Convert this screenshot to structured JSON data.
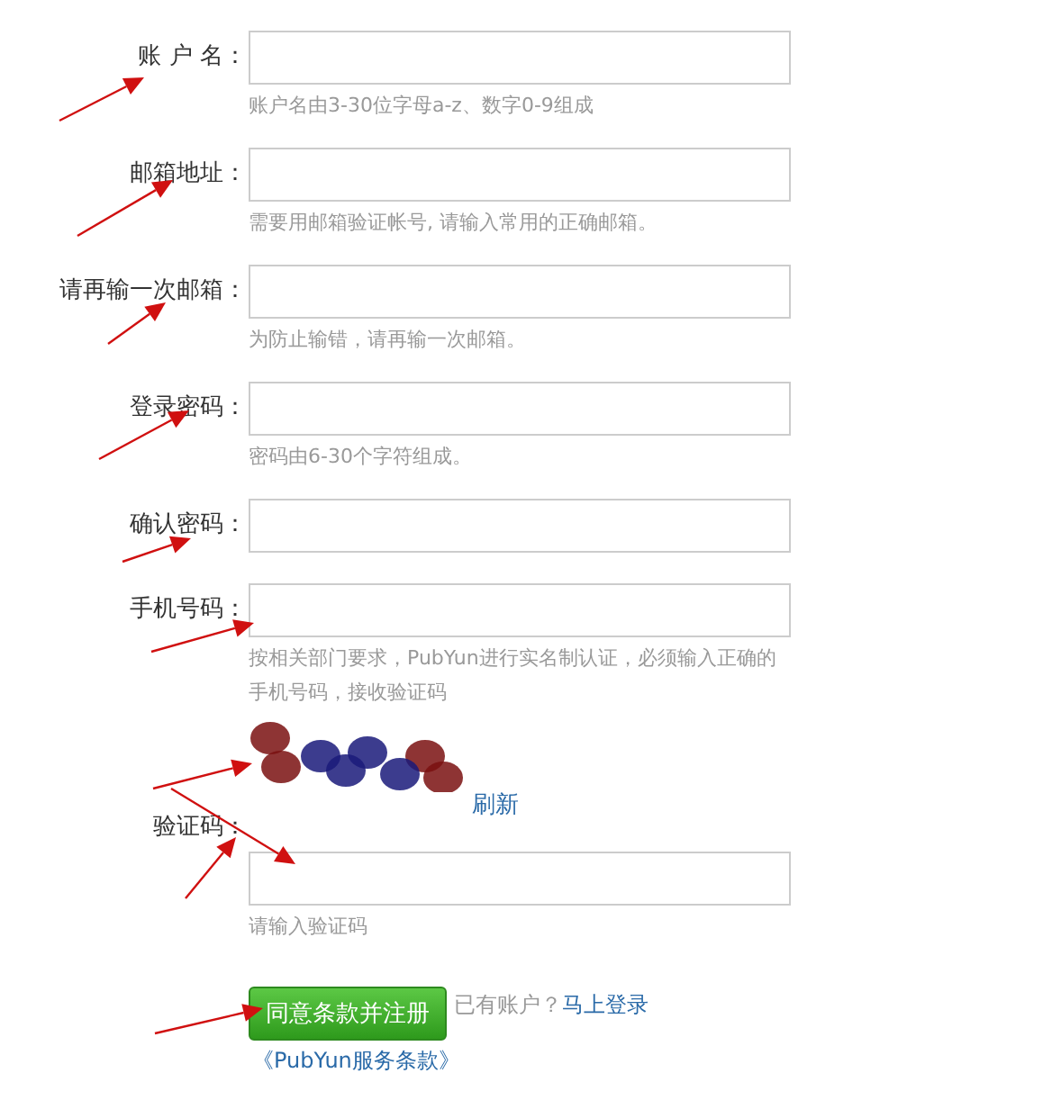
{
  "fields": [
    {
      "label": "账 户 名：",
      "hint": "账户名由3-30位字母a-z、数字0-9组成"
    },
    {
      "label": "邮箱地址：",
      "hint": "需要用邮箱验证帐号, 请输入常用的正确邮箱。"
    },
    {
      "label": "请再输一次邮箱：",
      "hint": "为防止输错，请再输一次邮箱。"
    },
    {
      "label": "登录密码：",
      "hint": "密码由6-30个字符组成。"
    },
    {
      "label": "确认密码："
    },
    {
      "label": "手机号码：",
      "hint": "按相关部门要求，PubYun进行实名制认证，必须输入正确的手机号码，接收验证码"
    }
  ],
  "captcha": {
    "label": "验证码：",
    "refresh": "刷新",
    "hint": "请输入验证码"
  },
  "submit": "同意条款并注册",
  "login_prompt": "已有账户？",
  "login_link": "马上登录",
  "terms_link": "《PubYun服务条款》"
}
